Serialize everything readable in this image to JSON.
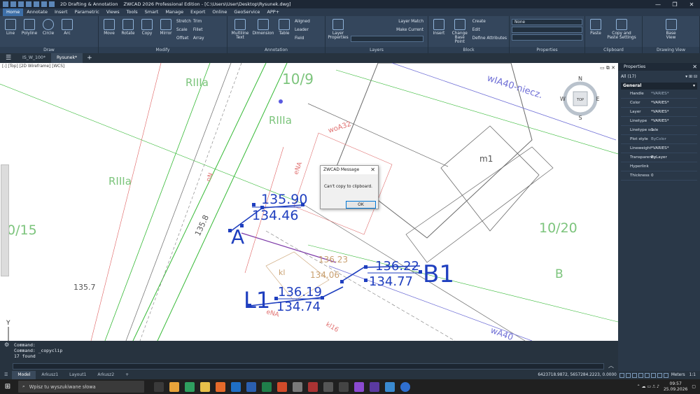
{
  "titlebar": {
    "workspace": "2D Drafting & Annotation",
    "title": "ZWCAD 2026 Professional Edition - [C:\\Users\\User\\Desktop\\Rysunek.dwg]",
    "minimize": "—",
    "maximize": "❐",
    "close": "✕"
  },
  "menu": [
    "Home",
    "Annotate",
    "Insert",
    "Parametric",
    "Views",
    "Tools",
    "Smart",
    "Manage",
    "Export",
    "Online",
    "GeoService",
    "APP+"
  ],
  "ribbon": {
    "draw": {
      "title": "Draw",
      "line": "Line",
      "polyline": "Polyline",
      "circle": "Circle",
      "arc": "Arc"
    },
    "modify": {
      "title": "Modify",
      "move": "Move",
      "rotate": "Rotate",
      "copy": "Copy",
      "mirror": "Mirror",
      "stretch": "Stretch",
      "scale": "Scale",
      "offset": "Offset",
      "trim": "Trim",
      "fillet": "Fillet",
      "array": "Array"
    },
    "annotation": {
      "title": "Annotation",
      "mtext": "Multiline Text",
      "dimension": "Dimension",
      "table": "Table",
      "aligned": "Aligned",
      "leader": "Leader",
      "field": "Field"
    },
    "layers": {
      "title": "Layers",
      "props": "Layer Properties",
      "match": "Layer Match",
      "make_current": "Make Current"
    },
    "block": {
      "title": "Block",
      "insert": "Insert",
      "change_base": "Change Base Point",
      "create": "Create",
      "edit": "Edit",
      "define_attr": "Define Attributes"
    },
    "properties": {
      "title": "Properties",
      "color_value": "None"
    },
    "clipboard": {
      "title": "Clipboard",
      "paste": "Paste",
      "copy_paste_settings": "Copy and Paste Settings"
    },
    "drawing_view": {
      "title": "Drawing View",
      "base_view": "Base View"
    }
  },
  "doctabs": {
    "tab1": "IS_W_100*",
    "tab2": "Rysunek*"
  },
  "viewport_label": "[-] [Top] [2D Wireframe] [WCS]",
  "drawing": {
    "texts": [
      "RIIIa",
      "10/9",
      "RIIIa",
      "woA32",
      "wIA40-niecz.",
      "m1",
      "RIIIa",
      "0/15",
      "10/20",
      "B",
      "135.8",
      "135.7",
      "136.23",
      "134.06",
      "nN",
      "eNA",
      "eNA",
      "kl",
      "kl16",
      "wA40"
    ],
    "dim1_top": "135.90",
    "dim1_bot": "134.46",
    "dim2_top": "136.22",
    "dim2_bot": "134.77",
    "b1": "B1",
    "dim3_top": "136.19",
    "dim3_bot": "134.74",
    "l1": "L1",
    "a_label": "A",
    "compass": {
      "n": "N",
      "s": "S",
      "e": "E",
      "w": "W",
      "top": "TOP"
    },
    "ucs_y": "Y"
  },
  "command": {
    "lines": [
      "Command:",
      "Command: _copyclip",
      "17 found"
    ]
  },
  "properties": {
    "title": "Properties",
    "selection": "All (17)",
    "section": "General",
    "rows": [
      {
        "k": "Handle",
        "v": "*VARIES*"
      },
      {
        "k": "Color",
        "v": "*VARIES*"
      },
      {
        "k": "Layer",
        "v": "*VARIES*"
      },
      {
        "k": "Linetype",
        "v": "*VARIES*"
      },
      {
        "k": "Linetype scale",
        "v": "1"
      },
      {
        "k": "Plot style",
        "v": "ByColor"
      },
      {
        "k": "Lineweight",
        "v": "*VARIES*"
      },
      {
        "k": "Transparency",
        "v": "ByLayer"
      },
      {
        "k": "Hyperlink",
        "v": ""
      },
      {
        "k": "Thickness",
        "v": "0"
      }
    ]
  },
  "dialog": {
    "title": "ZWCAD Message",
    "message": "Can't copy to clipboard.",
    "ok": "OK"
  },
  "status": {
    "tabs": [
      "Model",
      "Arkusz1",
      "Layout1",
      "Arkusz2"
    ],
    "coords": "6423718.9872, 5657284.2223, 0.0000",
    "units": "Meters",
    "scale": "1:1"
  },
  "taskbar": {
    "search_placeholder": "Wpisz tu wyszukiwane słowa",
    "time": "09:57",
    "date": "25.09.2026"
  },
  "colors": {
    "dim_blue": "#1f3fbf",
    "green_line": "#35b935",
    "text_green": "#7cc47c",
    "parcel_gray": "#6a6a6a"
  }
}
